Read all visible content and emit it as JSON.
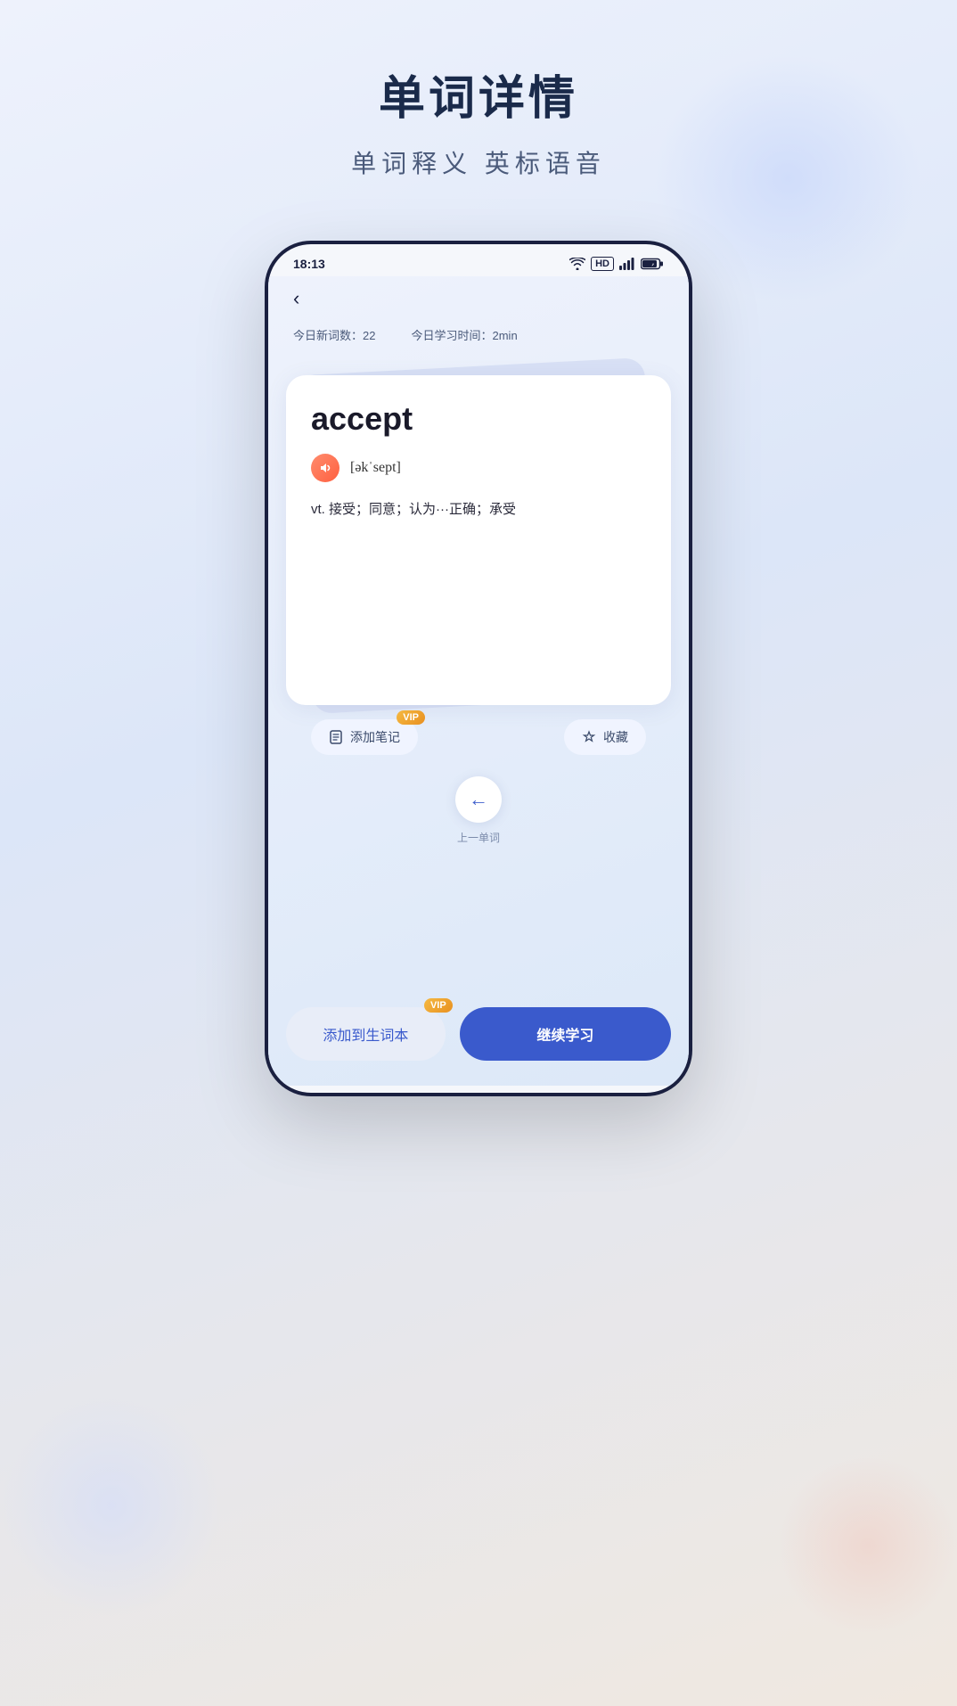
{
  "header": {
    "title": "单词详情",
    "subtitle": "单词释义 英标语音"
  },
  "status_bar": {
    "time": "18:13",
    "hd": "HD",
    "signal": "信号"
  },
  "stats": {
    "new_words_label": "今日新词数：",
    "new_words_value": "22",
    "study_time_label": "今日学习时间：",
    "study_time_value": "2min"
  },
  "word_card": {
    "word": "accept",
    "phonetic": "[əkˈsept]",
    "definition": "vt. 接受；同意；认为···正确；承受"
  },
  "actions": {
    "add_note": "添加笔记",
    "collect": "收藏",
    "vip_label": "VIP"
  },
  "navigation": {
    "prev_label": "上一单词",
    "arrow": "←"
  },
  "bottom": {
    "add_to_vocab": "添加到生词本",
    "continue_study": "继续学习",
    "vip_label": "VIP"
  }
}
